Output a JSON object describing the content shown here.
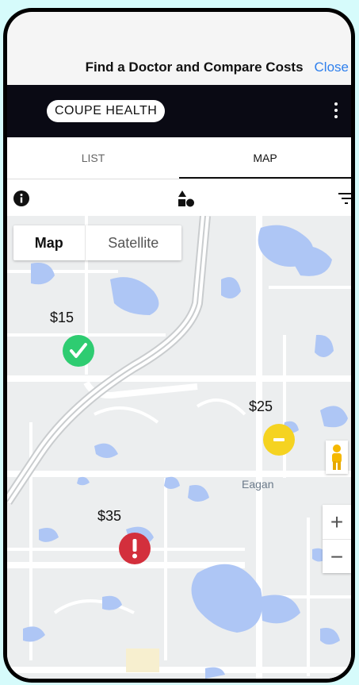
{
  "header": {
    "title": "Find a Doctor and Compare Costs",
    "close_label": "Close"
  },
  "brand": {
    "name": "COUPE HEALTH",
    "menu_icon": "kebab-menu-icon"
  },
  "tabs": [
    {
      "label": "LIST",
      "active": false
    },
    {
      "label": "MAP",
      "active": true
    }
  ],
  "toolbar": {
    "info_icon": "info-icon",
    "shapes_icon": "shapes-icon",
    "filter_icon": "filter-icon"
  },
  "map": {
    "type_control": {
      "map_label": "Map",
      "satellite_label": "Satellite",
      "selected": "Map"
    },
    "place_label": "Eagan",
    "markers": [
      {
        "price": "$15",
        "status": "check",
        "color": "#2ecc71"
      },
      {
        "price": "$25",
        "status": "minus",
        "color": "#f5d321"
      },
      {
        "price": "$35",
        "status": "alert",
        "color": "#d32f3c"
      }
    ],
    "zoom_in_label": "+",
    "zoom_out_label": "−"
  },
  "colors": {
    "accent": "#2f80ed",
    "brand_bar": "#0a0a14",
    "water": "#aec6f5"
  }
}
